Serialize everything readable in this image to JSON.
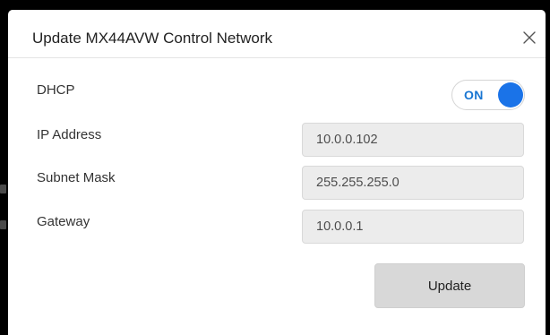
{
  "dialog": {
    "title": "Update MX44AVW Control Network",
    "close_icon": "close-icon",
    "close_glyph": "×"
  },
  "form": {
    "dhcp": {
      "label": "DHCP",
      "toggle_text": "ON",
      "enabled": true
    },
    "ip_address": {
      "label": "IP Address",
      "value": "10.0.0.102"
    },
    "subnet_mask": {
      "label": "Subnet Mask",
      "value": "255.255.255.0"
    },
    "gateway": {
      "label": "Gateway",
      "value": "10.0.0.1"
    }
  },
  "actions": {
    "update_label": "Update"
  },
  "colors": {
    "accent": "#1a73e8",
    "toggle_text": "#1976d2",
    "field_background": "#ececec",
    "button_background": "#d8d8d8",
    "backdrop": "#000000"
  }
}
